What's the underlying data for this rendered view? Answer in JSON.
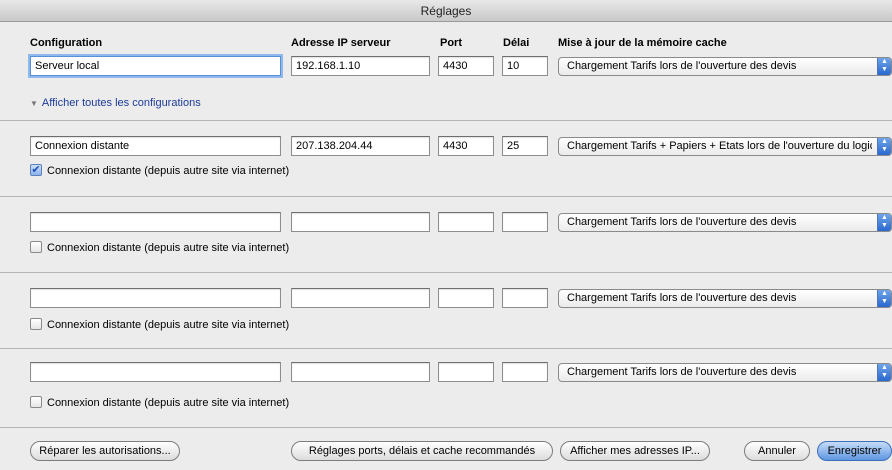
{
  "window": {
    "title": "Réglages"
  },
  "headers": {
    "configuration": "Configuration",
    "ip": "Adresse IP serveur",
    "port": "Port",
    "delay": "Délai",
    "cache": "Mise à jour de la mémoire cache"
  },
  "rows": [
    {
      "name": "Serveur local",
      "ip": "192.168.1.10",
      "port": "4430",
      "delay": "10",
      "cache": "Chargement Tarifs lors de l'ouverture des devis",
      "remote_checked": null
    },
    {
      "name": "Connexion distante",
      "ip": "207.138.204.44",
      "port": "4430",
      "delay": "25",
      "cache": "Chargement Tarifs + Papiers + Etats lors de l'ouverture du logic...",
      "remote_checked": true
    },
    {
      "name": "",
      "ip": "",
      "port": "",
      "delay": "",
      "cache": "Chargement Tarifs lors de l'ouverture des devis",
      "remote_checked": false
    },
    {
      "name": "",
      "ip": "",
      "port": "",
      "delay": "",
      "cache": "Chargement Tarifs lors de l'ouverture des devis",
      "remote_checked": false
    },
    {
      "name": "",
      "ip": "",
      "port": "",
      "delay": "",
      "cache": "Chargement Tarifs lors de l'ouverture des devis",
      "remote_checked": false
    }
  ],
  "remote_label": "Connexion distante (depuis autre site via internet)",
  "show_all": "Afficher toutes les configurations",
  "buttons": {
    "repair": "Réparer les autorisations...",
    "recommended": "Réglages ports, délais et cache recommandés",
    "show_ip": "Afficher mes adresses IP...",
    "cancel": "Annuler",
    "save": "Enregistrer"
  },
  "icons": {
    "disclosure": "disclosure-triangle-icon",
    "select_arrows": "updown-arrows-icon",
    "check": "checkmark-icon"
  }
}
